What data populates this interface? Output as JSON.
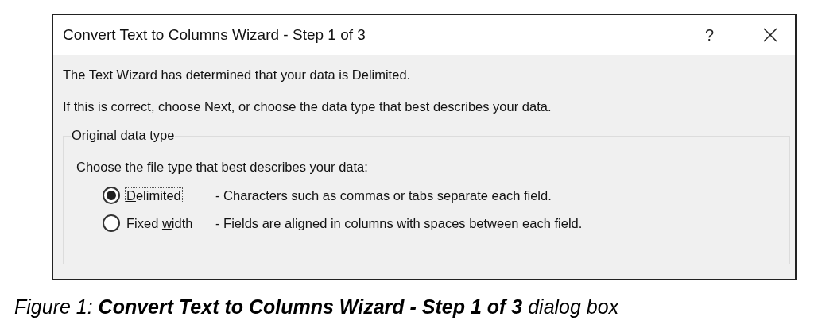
{
  "dialog": {
    "title": "Convert Text to Columns Wizard - Step 1 of 3",
    "help": "?",
    "messages": [
      "The Text Wizard has determined that your data is Delimited.",
      "If this is correct, choose Next, or choose the data type that best describes your data."
    ],
    "group": {
      "label": "Original data type",
      "prompt": "Choose the file type that best describes your data:",
      "options": [
        {
          "access_key": "D",
          "label_after": "elimited",
          "description": "- Characters such as commas or tabs separate each field.",
          "selected": true
        },
        {
          "label_before": "Fixed ",
          "access_key": "w",
          "label_after": "idth",
          "description": "- Fields are aligned in columns with spaces between each field.",
          "selected": false
        }
      ]
    }
  },
  "caption": "Figure 1: **Convert Text to Columns Wizard - Step 1 of 3** dialog box"
}
